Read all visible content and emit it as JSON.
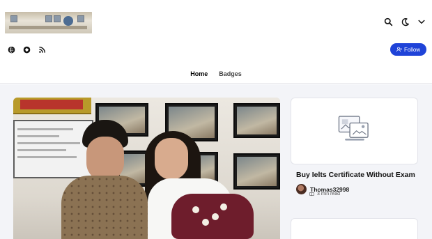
{
  "header": {
    "icons": [
      "search-icon",
      "moon-icon",
      "chevron-down-icon"
    ]
  },
  "social": {
    "icons": [
      "globe-icon",
      "diamond-icon",
      "rss-icon"
    ]
  },
  "follow_button": {
    "label": "Follow",
    "icon": "user-plus-icon",
    "color": "#1f43d8"
  },
  "nav": {
    "tabs": [
      {
        "label": "Home",
        "active": true
      },
      {
        "label": "Badges",
        "active": false
      }
    ]
  },
  "featured_post": {
    "image": "photo-two-people-with-flowers"
  },
  "sidebar_post": {
    "image_icon": "image-placeholder-icon",
    "title": "Buy Ielts Certificate Without Exam",
    "author": "Thomas32998",
    "read_time": "3 min read"
  },
  "colors": {
    "page_bg": "#f3f4f8",
    "accent": "#1f43d8"
  }
}
